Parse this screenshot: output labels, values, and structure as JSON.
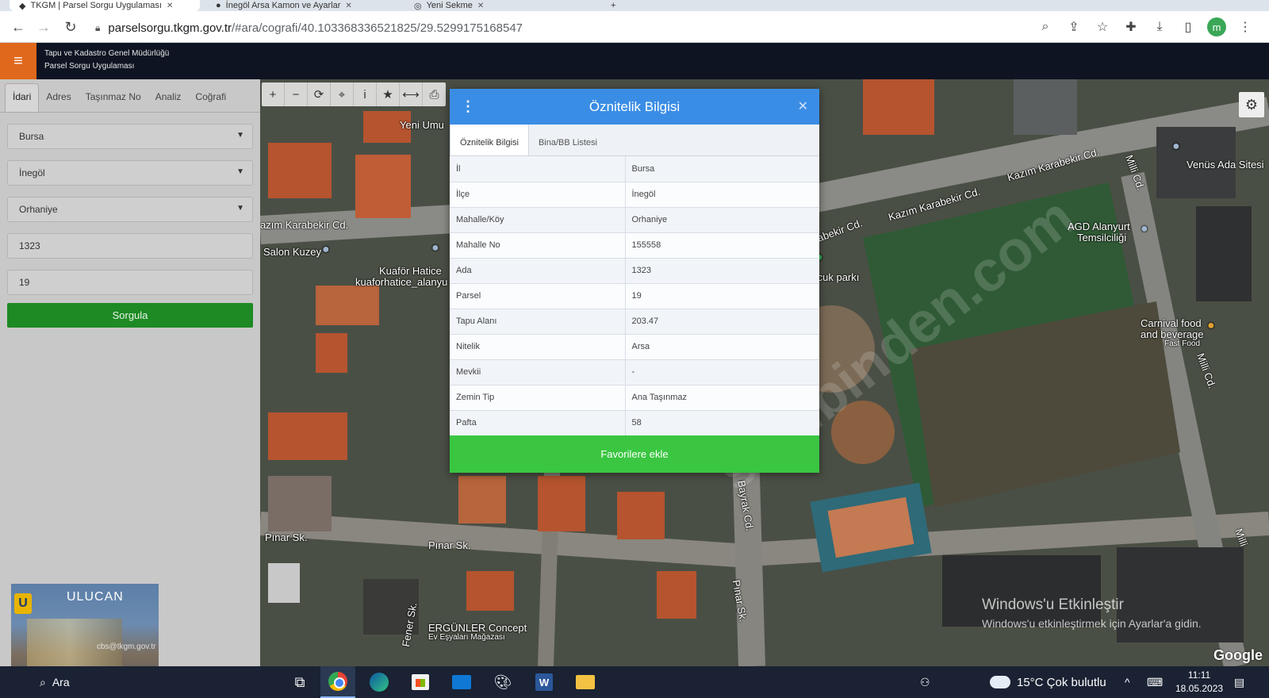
{
  "browser": {
    "tabs": [
      {
        "label": "TKGM | Parsel Sorgu Uygulaması",
        "active": true
      },
      {
        "label": "İnegöl Arsa Kamon ve Ayarlar",
        "active": false
      },
      {
        "label": "Yeni Sekme",
        "active": false
      }
    ],
    "url_host": "parselsorgu.tkgm.gov.tr",
    "url_path": "/#ara/cografi/40.103368336521825/29.5299175168547",
    "profile_letter": "m"
  },
  "app": {
    "org_name": "Tapu ve Kadastro Genel Müdürlüğü",
    "app_name": "Parsel Sorgu Uygulaması",
    "brand_color": "#e0681c"
  },
  "left_panel": {
    "tabs": [
      "İdari",
      "Adres",
      "Taşınmaz No",
      "Analiz",
      "Coğrafi"
    ],
    "active_tab": "İdari",
    "il": "Bursa",
    "ilce": "İnegöl",
    "mahalle": "Orhaniye",
    "ada": "1323",
    "parsel": "19",
    "submit_label": "Sorgula"
  },
  "logo": {
    "name": "ULUCAN",
    "letter": "U",
    "email": "cbs@tkgm.gov.tr"
  },
  "dialog": {
    "title": "Öznitelik Bilgisi",
    "tabs": [
      "Öznitelik Bilgisi",
      "Bina/BB Listesi"
    ],
    "active_tab": "Öznitelik Bilgisi",
    "rows": [
      {
        "key": "İl",
        "value": "Bursa"
      },
      {
        "key": "İlçe",
        "value": "İnegöl"
      },
      {
        "key": "Mahalle/Köy",
        "value": "Orhaniye"
      },
      {
        "key": "Mahalle No",
        "value": "155558"
      },
      {
        "key": "Ada",
        "value": "1323"
      },
      {
        "key": "Parsel",
        "value": "19"
      },
      {
        "key": "Tapu Alanı",
        "value": "203.47"
      },
      {
        "key": "Nitelik",
        "value": "Arsa"
      },
      {
        "key": "Mevkii",
        "value": "-"
      },
      {
        "key": "Zemin Tip",
        "value": "Ana Taşınmaz"
      },
      {
        "key": "Pafta",
        "value": "58"
      }
    ],
    "favorite_label": "Favorilere ekle"
  },
  "map": {
    "labels": {
      "yeni_umut": "Yeni Umu",
      "kazim_left": "azım Karabekir Cd.",
      "salon_kuzey": "Salon Kuzey",
      "kuafor": "Kuaför Hatice",
      "kuafor_handle": "kuaforhatice_alanyu",
      "kazim_right1": "Kazım Karabekir Cd.",
      "kazim_right2": "Kazım Karabekir Cd.",
      "karabekir_cd": "arabekir Cd.",
      "milli_cd1": "Milli Cd.",
      "milli_cd2": "Milli Cd.",
      "milli_cd3": "Milli",
      "venus": "Venüs Ada Sitesi",
      "agd": "AGD Alanyurt",
      "agd2": "Temsilciliği",
      "cocuk": "Çocuk parkı",
      "carnival1": "Carnival food",
      "carnival2": "and beverage",
      "carnival3": "Fast Food",
      "pinar_sk1": "Pınar Sk.",
      "pinar_sk2": "Pınar Sk.",
      "pinar_sk3": "Pınar Sk.",
      "bayrak": "Bayrak Cd.",
      "fener": "Fener Sk.",
      "ergunler": "ERGÜNLER Concept",
      "ergunler2": "Ev Eşyaları Mağazası",
      "watermark": "sahibinden.com"
    },
    "windows_activate_title": "Windows'u Etkinleştir",
    "windows_activate_sub": "Windows'u etkinleştirmek için Ayarlar'a gidin.",
    "google": "Google"
  },
  "taskbar": {
    "search_label": "Ara",
    "weather": "15°C  Çok bulutlu",
    "time": "11:11",
    "date": "18.05.2023"
  }
}
